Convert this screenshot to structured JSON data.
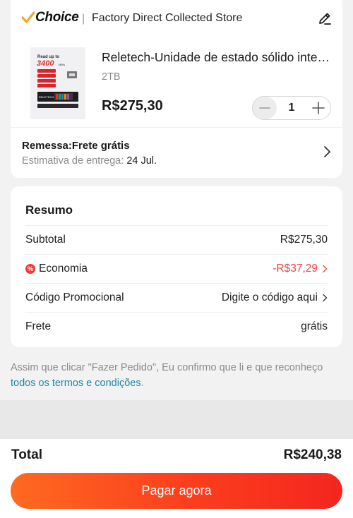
{
  "store": {
    "badge": "Choice",
    "separator": "|",
    "name": "Factory Direct Collected Store"
  },
  "product": {
    "title": "Reletech-Unidade de estado sólido interna NVMe",
    "variant": "2TB",
    "price": "R$275,30",
    "quantity": "1",
    "image_text_top": "Read up to",
    "image_speed": "3400",
    "image_speed_unit": "MB/s",
    "image_brand": "RELETECH"
  },
  "shipping": {
    "title": "Remessa:Frete grátis",
    "estimate_label": "Estimativa de entrega: ",
    "estimate_date": "24 Jul."
  },
  "summary": {
    "title": "Resumo",
    "rows": [
      {
        "label": "Subtotal",
        "value": "R$275,30"
      },
      {
        "label": "Economia",
        "value": "-R$37,29"
      },
      {
        "label": "Código Promocional",
        "value": "Digite o código aqui"
      },
      {
        "label": "Frete",
        "value": "grátis"
      }
    ]
  },
  "terms": {
    "text": "Assim que clicar \"Fazer Pedido\", Eu confirmo que li e que reconheço ",
    "link": "todos os termos e condições",
    "end": "."
  },
  "footer": {
    "total_label": "Total",
    "total_value": "R$240,38",
    "pay_label": "Pagar agora"
  },
  "colors": {
    "choice_check": "#f5a623",
    "discount": "#ef4444",
    "link": "#1a87a8",
    "pay_button_start": "#ff6a21",
    "pay_button_end": "#f4261f"
  }
}
